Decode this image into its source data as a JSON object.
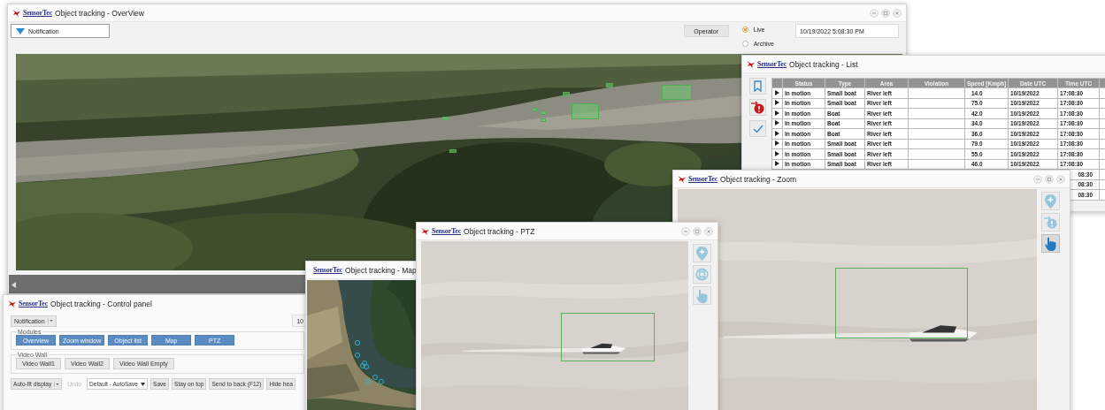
{
  "overview": {
    "logo": "SensorTec",
    "title": "Object tracking - OverView",
    "window_controls": [
      {
        "kind": "minimize"
      },
      {
        "kind": "maximize"
      },
      {
        "kind": "close"
      }
    ],
    "notification": "Notification",
    "operator_button": "Operator",
    "modes": [
      {
        "label": "Live",
        "selected": true
      },
      {
        "label": "Archive",
        "selected": false
      }
    ],
    "datetime": "10/19/2022 5:08:30 PM"
  },
  "object_list": {
    "logo": "SensorTec",
    "title": "Object tracking - List",
    "side_buttons": [
      {
        "kind": "bookmark"
      },
      {
        "kind": "alert"
      },
      {
        "kind": "check"
      }
    ],
    "columns": [
      "Status",
      "Type",
      "Area",
      "Violation",
      "Speed [Kmph]",
      "Date UTC",
      "Time UTC"
    ],
    "rows": [
      {
        "status": "In motion",
        "type": "Small boat",
        "area": "River left",
        "speed": "14.0",
        "date": "10/19/2022",
        "time": "17:08:30"
      },
      {
        "status": "In motion",
        "type": "Small boat",
        "area": "River left",
        "speed": "75.0",
        "date": "10/19/2022",
        "time": "17:08:30"
      },
      {
        "status": "In motion",
        "type": "Boat",
        "area": "River left",
        "speed": "42.0",
        "date": "10/19/2022",
        "time": "17:08:30"
      },
      {
        "status": "In motion",
        "type": "Boat",
        "area": "River left",
        "speed": "34.0",
        "date": "10/19/2022",
        "time": "17:08:30"
      },
      {
        "status": "In motion",
        "type": "Boat",
        "area": "River left",
        "speed": "36.0",
        "date": "10/19/2022",
        "time": "17:08:30"
      },
      {
        "status": "In motion",
        "type": "Small boat",
        "area": "River left",
        "speed": "79.0",
        "date": "10/19/2022",
        "time": "17:08:30"
      },
      {
        "status": "In motion",
        "type": "Small boat",
        "area": "River left",
        "speed": "55.0",
        "date": "10/19/2022",
        "time": "17:08:30"
      },
      {
        "status": "In motion",
        "type": "Small boat",
        "area": "River left",
        "speed": "46.0",
        "date": "10/19/2022",
        "time": "17:08:30"
      }
    ],
    "partial_rows": [
      {
        "time": "08:30"
      },
      {
        "time": "08:30"
      },
      {
        "time": "08:30"
      }
    ]
  },
  "zoom": {
    "logo": "SensorTec",
    "title": "Object tracking - Zoom",
    "window_controls": [
      {
        "kind": "minimize"
      },
      {
        "kind": "maximize"
      },
      {
        "kind": "close"
      }
    ],
    "side_buttons": [
      {
        "kind": "add-marker",
        "selected": false
      },
      {
        "kind": "alert",
        "selected": false
      },
      {
        "kind": "hand",
        "selected": true
      }
    ]
  },
  "control_panel": {
    "logo": "SensorTec",
    "title": "Object tracking - Control panel",
    "notification": "Notification",
    "counter": "10",
    "modules": {
      "legend": "Modules",
      "buttons": [
        "Overview",
        "Zoom window",
        "Object list",
        "Map",
        "PTZ"
      ]
    },
    "video_wall": {
      "legend": "Video Wall",
      "buttons": [
        "Video Wall1",
        "Video Wall2",
        "Video Wall Empty"
      ]
    },
    "toolbar": [
      {
        "kind": "split",
        "label": "Auto-fit display",
        "disabled": false
      },
      {
        "kind": "button",
        "label": "Undo",
        "disabled": true
      },
      {
        "kind": "select",
        "label": "Default - AutoSave",
        "disabled": false
      },
      {
        "kind": "button",
        "label": "Save",
        "disabled": false
      },
      {
        "kind": "button",
        "label": "Stay on top",
        "disabled": false
      },
      {
        "kind": "button",
        "label": "Send to back (F12)",
        "disabled": false
      },
      {
        "kind": "button",
        "label": "Hide hea",
        "disabled": false
      }
    ]
  },
  "map": {
    "logo": "SensorTec",
    "title": "Object tracking - Map"
  },
  "ptz": {
    "logo": "SensorTec",
    "title": "Object tracking - PTZ",
    "window_controls": [
      {
        "kind": "minimize"
      },
      {
        "kind": "maximize"
      },
      {
        "kind": "close"
      }
    ],
    "side_buttons": [
      {
        "kind": "add-marker",
        "selected": false
      },
      {
        "kind": "target",
        "selected": false
      },
      {
        "kind": "hand",
        "selected": false
      }
    ]
  }
}
